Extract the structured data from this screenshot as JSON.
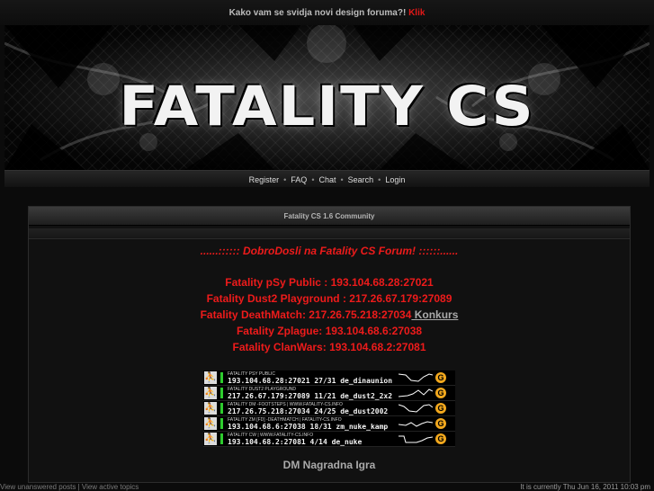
{
  "topbar": {
    "question": "Kako vam se svidja novi design foruma?!",
    "link": "Klik"
  },
  "banner": {
    "logo_text": "FATALITY CS"
  },
  "nav": {
    "items": [
      "Register",
      "FAQ",
      "Chat",
      "Search",
      "Login"
    ],
    "separator": "•"
  },
  "panel": {
    "title": "Fatality CS 1.6 Community",
    "welcome": "......:::::: DobroDosli na Fatality CS Forum! ::::::......",
    "servers": [
      {
        "text": "Fatality pSy Public : 193.104.68.28:27021",
        "extra": ""
      },
      {
        "text": "Fatality Dust2 Playground : 217.26.67.179:27089",
        "extra": ""
      },
      {
        "text": "Fatality DeathMatch: 217.26.75.218:27034",
        "extra": " Konkurs"
      },
      {
        "text": "Fatality Zplague: 193.104.68.6:27038",
        "extra": ""
      },
      {
        "text": "Fatality ClanWars: 193.104.68.2:27081",
        "extra": ""
      }
    ],
    "gametracker": [
      {
        "name": "FATALITY PSY PUBLIC",
        "info": "193.104.68.28:27021  27/31  de_dinaunion"
      },
      {
        "name": "FATALITY DUST2 PLAYGROUND",
        "info": "217.26.67.179:27089  11/21  de_dust2_2x2"
      },
      {
        "name": "FATALITY DM -FOOTSTEPS | WWW.FATALITY-CS.INFO",
        "info": "217.26.75.218:27034  24/25  de_dust2002"
      },
      {
        "name": "FATALITY ZM [FD] -DEATHMATCH | FATALITY-CS.INFO",
        "info": "193.104.68.6:27038  18/31  zm_nuke_kamp"
      },
      {
        "name": "FATALITY CW | WWW.FATALITY-CS.INFO",
        "info": "193.104.68.2:27081  4/14  de_nuke"
      }
    ],
    "gt_logo": "G",
    "dm_text": "DM Nagradna Igra"
  },
  "footer": {
    "left": "View unanswered posts | View active topics",
    "right": "It is currently Thu Jun 16, 2011 10:03 pm"
  },
  "colors": {
    "accent_red": "#ee1b1b",
    "background": "#0b0b0b",
    "gray_text": "#aaaaaa"
  }
}
